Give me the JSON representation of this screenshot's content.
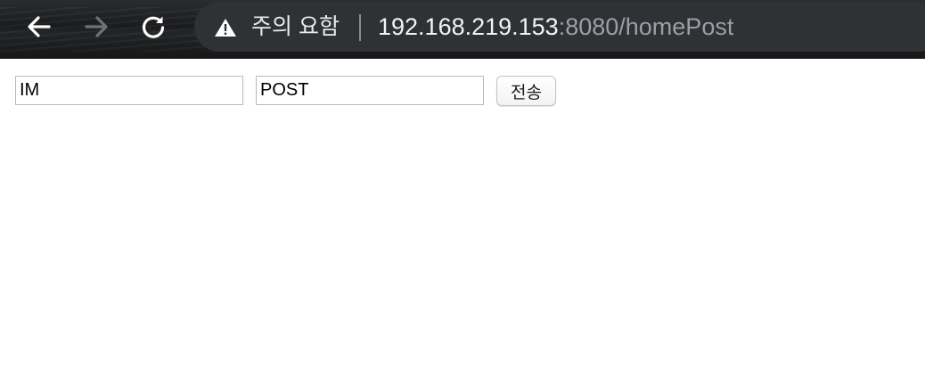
{
  "browser": {
    "security_label": "주의 요함",
    "url_host": "192.168.219.153",
    "url_rest": ":8080/homePost",
    "icons": {
      "back": "arrow-left-icon",
      "forward": "arrow-right-icon",
      "reload": "reload-icon",
      "security": "warning-triangle-icon"
    },
    "colors": {
      "toolbar": "#202124",
      "omnibox": "#2f3134",
      "url_host": "#f1f3f4",
      "url_rest": "#9aa0a6"
    }
  },
  "form": {
    "field1_value": "IM",
    "field2_value": "POST",
    "submit_label": "전송"
  }
}
